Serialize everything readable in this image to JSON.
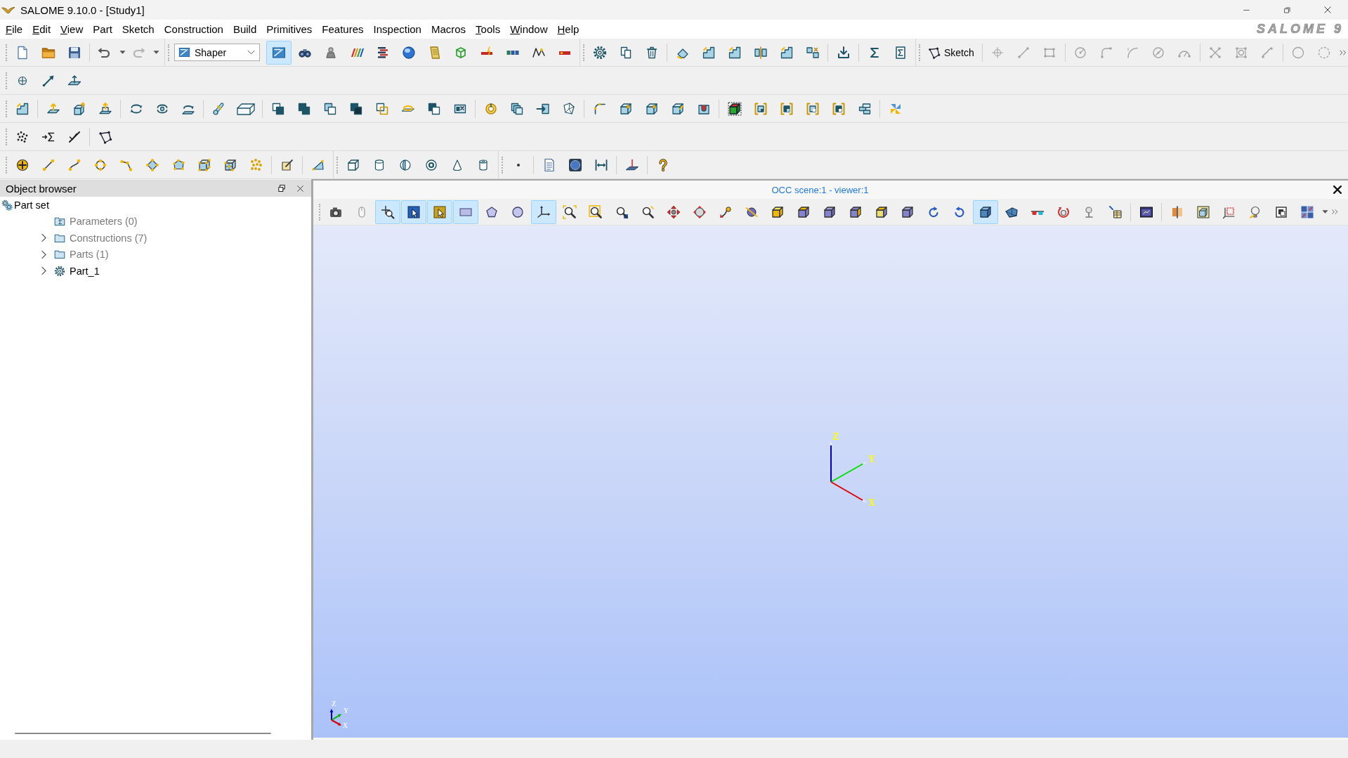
{
  "window": {
    "title": "SALOME 9.10.0 - [Study1]"
  },
  "menu": [
    {
      "label": "File",
      "mnemonic": true
    },
    {
      "label": "Edit",
      "mnemonic": true
    },
    {
      "label": "View",
      "mnemonic": true
    },
    {
      "label": "Part",
      "mnemonic": false
    },
    {
      "label": "Sketch",
      "mnemonic": false
    },
    {
      "label": "Construction",
      "mnemonic": false
    },
    {
      "label": "Build",
      "mnemonic": false
    },
    {
      "label": "Primitives",
      "mnemonic": false
    },
    {
      "label": "Features",
      "mnemonic": false
    },
    {
      "label": "Inspection",
      "mnemonic": false
    },
    {
      "label": "Macros",
      "mnemonic": false
    },
    {
      "label": "Tools",
      "mnemonic": true
    },
    {
      "label": "Window",
      "mnemonic": true
    },
    {
      "label": "Help",
      "mnemonic": true
    }
  ],
  "logo": "SALOME 9",
  "edit_toolbar": {
    "undo": {
      "disabled": false
    },
    "redo": {
      "disabled": true
    }
  },
  "module_selector": {
    "value": "Shaper"
  },
  "module_buttons": [
    {
      "selected": true
    },
    {
      "selected": false
    },
    {
      "selected": false
    },
    {
      "selected": false
    },
    {
      "selected": false
    },
    {
      "selected": false
    },
    {
      "selected": false
    },
    {
      "selected": false
    },
    {
      "selected": false
    },
    {
      "selected": false
    },
    {
      "selected": false
    },
    {
      "selected": false
    }
  ],
  "sketch_toolbar": {
    "button": "Sketch",
    "tools_disabled": true
  },
  "object_browser": {
    "title": "Object browser",
    "tree": [
      {
        "label": "Part set",
        "kind": "partset",
        "children": [
          {
            "label": "Parameters (0)",
            "kind": "parameters",
            "dimmed": true,
            "expandable": false,
            "expanded": false
          },
          {
            "label": "Constructions (7)",
            "kind": "folder",
            "dimmed": true,
            "expandable": true,
            "expanded": false
          },
          {
            "label": "Parts (1)",
            "kind": "folder",
            "dimmed": true,
            "expandable": true,
            "expanded": false
          },
          {
            "label": "Part_1",
            "kind": "part",
            "dimmed": false,
            "expandable": true,
            "expanded": false
          }
        ]
      }
    ]
  },
  "viewer": {
    "title": "OCC scene:1 - viewer:1",
    "toolbar": [
      {
        "selected": false
      },
      {
        "selected": false
      },
      {
        "selected": true
      },
      {
        "selected": true
      },
      {
        "selected": true
      },
      {
        "selected": true
      },
      {
        "selected": false
      },
      {
        "selected": false
      },
      {
        "selected": true
      },
      {
        "selected": false
      },
      {
        "selected": false
      },
      {
        "selected": false
      },
      {
        "selected": false
      },
      {
        "selected": false
      },
      {
        "selected": false
      },
      {
        "selected": false
      },
      {
        "selected": false
      },
      {
        "selected": false
      },
      {
        "selected": false
      },
      {
        "selected": false
      },
      {
        "selected": false
      },
      {
        "selected": false
      },
      {
        "selected": false
      },
      {
        "selected": false
      },
      {
        "selected": false
      },
      {
        "selected": true
      },
      {
        "selected": false
      },
      {
        "selected": false
      },
      {
        "selected": false
      },
      {
        "selected": false
      },
      {
        "selected": false
      },
      {
        "selected": false
      },
      {
        "selected": false
      },
      {
        "selected": false
      },
      {
        "selected": false
      },
      {
        "selected": false
      },
      {
        "selected": false
      },
      {
        "selected": false
      }
    ],
    "trihedron_labels": [
      "X",
      "Y",
      "Z"
    ],
    "corner_trihedron_labels": [
      "X",
      "Y",
      "Z"
    ]
  }
}
